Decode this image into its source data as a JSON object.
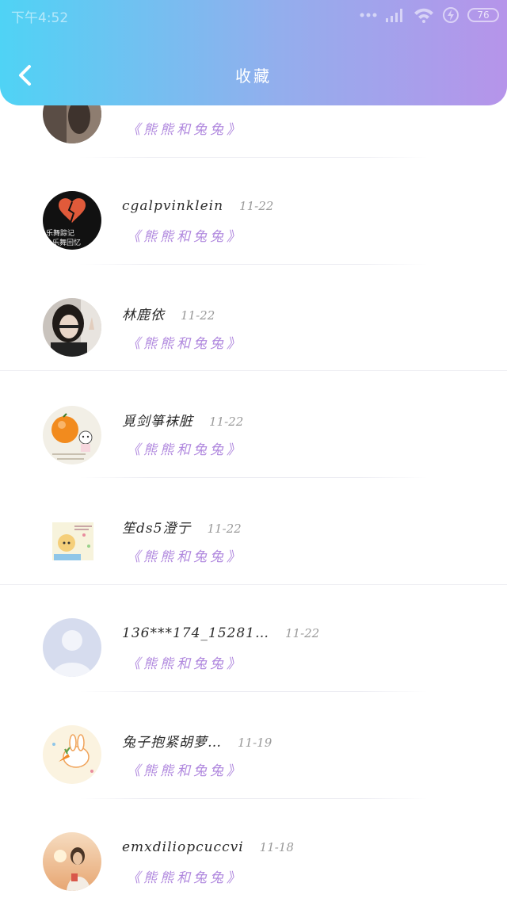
{
  "status_bar": {
    "time": "下午4:52",
    "battery": "76"
  },
  "header": {
    "title": "收藏"
  },
  "favorites": [
    {
      "name": "",
      "date": "",
      "work": "《熊熊和兔兔》"
    },
    {
      "name": "cgalpvinklein",
      "date": "11-22",
      "work": "《熊熊和兔兔》"
    },
    {
      "name": "林鹿依",
      "date": "11-22",
      "work": "《熊熊和兔兔》"
    },
    {
      "name": "覓剑箏袜脏",
      "date": "11-22",
      "work": "《熊熊和兔兔》"
    },
    {
      "name": "笙ds5澄亍",
      "date": "11-22",
      "work": "《熊熊和兔兔》"
    },
    {
      "name": "136***174_15281…",
      "date": "11-22",
      "work": "《熊熊和兔兔》"
    },
    {
      "name": "兔子抱紧胡萝…",
      "date": "11-19",
      "work": "《熊熊和兔兔》"
    },
    {
      "name": "emxdiliopcuccvi",
      "date": "11-18",
      "work": "《熊熊和兔兔》"
    }
  ],
  "avatar_text": [
    "乐舞踪记",
    "乐舞回忆"
  ]
}
